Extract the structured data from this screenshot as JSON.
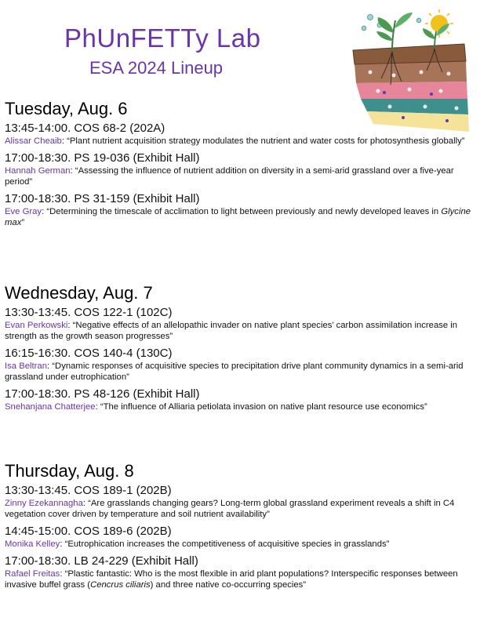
{
  "header": {
    "title": "PhUnFETTy Lab",
    "subtitle": "ESA 2024 Lineup"
  },
  "colors": {
    "accent_purple": "#6a35a6",
    "soil_brown": "#8a5a3c",
    "soil_pink": "#e7869b",
    "soil_teal": "#3f8f8e",
    "soil_yellow": "#f5e39a",
    "leaf_green": "#4c9a52",
    "sun_yellow": "#f2c21b"
  },
  "days": [
    {
      "heading": "Tuesday, Aug. 6",
      "talks": [
        {
          "session": "13:45-14:00. COS 68-2 (202A)",
          "speaker": "Alissar Cheaib",
          "title_before": ": “Plant nutrient acquisition strategy modulates the nutrient and water costs for photosynthesis globally”",
          "title_species": "",
          "title_after": ""
        },
        {
          "session": "17:00-18:30. PS 19-036 (Exhibit Hall)",
          "speaker": "Hannah German",
          "title_before": ": “Assessing the influence of nutrient addition on diversity in a semi-arid grassland over a five-year period”",
          "title_species": "",
          "title_after": ""
        },
        {
          "session": "17:00-18:30. PS 31-159 (Exhibit Hall)",
          "speaker": "Eve Gray",
          "title_before": ": “Determining the timescale of acclimation to light between previously and newly developed leaves in ",
          "title_species": "Glycine max",
          "title_after": "”"
        }
      ]
    },
    {
      "heading": "Wednesday, Aug. 7",
      "talks": [
        {
          "session": "13:30-13:45. COS 122-1 (102C)",
          "speaker": "Evan Perkowski",
          "title_before": ": “Negative effects of an allelopathic invader on native plant species’ carbon assimilation increase in strength as the growth season progresses”",
          "title_species": "",
          "title_after": ""
        },
        {
          "session": "16:15-16:30. COS 140-4 (130C)",
          "speaker": "Isa Beltran",
          "title_before": ": “Dynamic responses of acquisitive species to precipitation drive plant community dynamics in a semi-arid grassland under eutrophication”",
          "title_species": "",
          "title_after": ""
        },
        {
          "session": "17:00-18:30. PS 48-126 (Exhibit Hall)",
          "speaker": "Snehanjana Chatterjee",
          "title_before": ": “The influence of Alliaria petiolata invasion on native plant resource use economics”",
          "title_species": "",
          "title_after": ""
        }
      ]
    },
    {
      "heading": "Thursday, Aug. 8",
      "talks": [
        {
          "session": "13:30-13:45. COS 189-1 (202B)",
          "speaker": "Zinny Ezekannagha",
          "title_before": ": “Are grasslands changing gears? Long-term global grassland experiment reveals a shift in C4 vegetation cover driven by temperature and soil nutrient availability”",
          "title_species": "",
          "title_after": ""
        },
        {
          "session": "14:45-15:00. COS 189-6 (202B)",
          "speaker": "Monika Kelley",
          "title_before": ": “Eutrophication increases the competitiveness of acquisitive species in grasslands”",
          "title_species": "",
          "title_after": ""
        },
        {
          "session": "17:00-18:30. LB 24-229 (Exhibit Hall)",
          "speaker": "Rafael Freitas",
          "title_before": ": “Plastic fantastic: Who is the most flexible in arid plant populations? Interspecific responses between invasive buffel grass (",
          "title_species": "Cencrus ciliaris",
          "title_after": ") and three native co-occurring species”"
        }
      ]
    }
  ]
}
